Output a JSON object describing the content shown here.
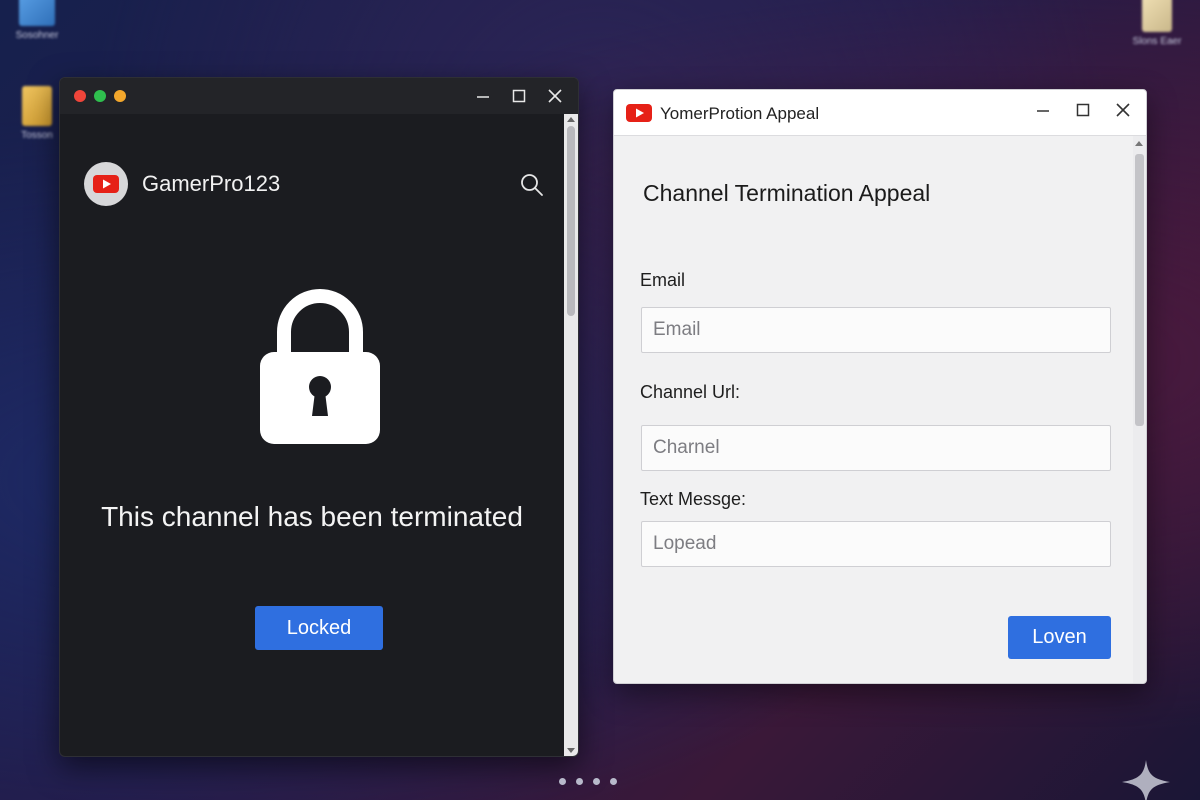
{
  "desktop": {
    "icons": [
      {
        "label": "Sosohner",
        "icon": "monitor-icon"
      },
      {
        "label": "Tosson",
        "icon": "folder-icon"
      },
      {
        "label": "Slons Eaer",
        "icon": "document-icon"
      }
    ]
  },
  "left_window": {
    "channel_name": "GamerPro123",
    "message": "This channel has been terminated",
    "button_label": "Locked",
    "icons": [
      "youtube-logo-icon",
      "search-icon",
      "lock-icon"
    ]
  },
  "right_window": {
    "title": "YomerProtion Appeal",
    "form_title": "Channel Termination Appeal",
    "fields": [
      {
        "label": "Email",
        "placeholder": "Email"
      },
      {
        "label": "Channel Url:",
        "placeholder": "Charnel"
      },
      {
        "label": "Text Messge:",
        "placeholder": "Lopead"
      }
    ],
    "submit_label": "Loven"
  },
  "taskbar": {
    "page_dots": 4
  },
  "colors": {
    "accent_blue": "#2f6fe0",
    "youtube_red": "#e62117",
    "dark_window": "#1b1c20"
  }
}
